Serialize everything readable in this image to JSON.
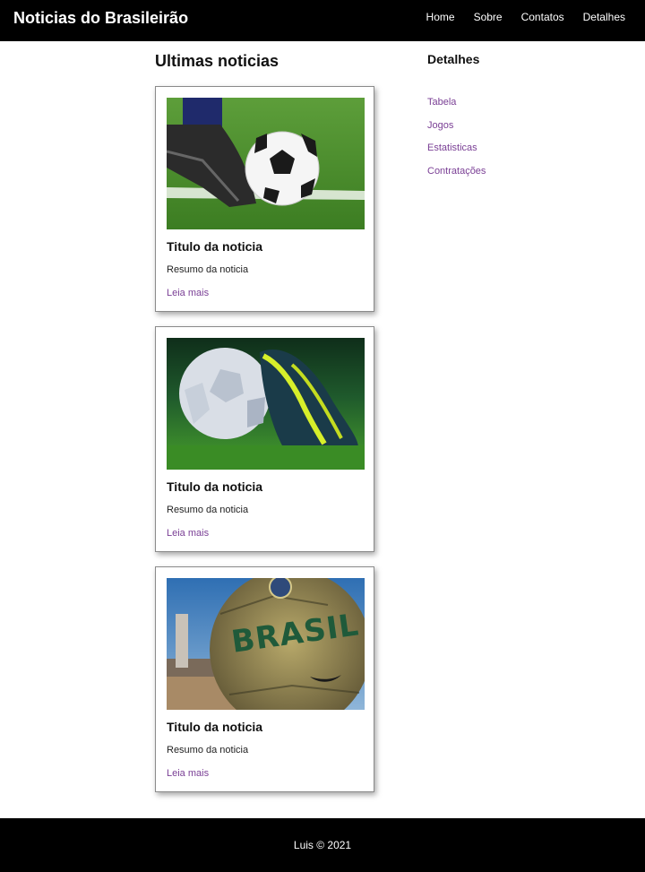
{
  "header": {
    "brand": "Noticias do Brasileirão",
    "nav": [
      "Home",
      "Sobre",
      "Contatos",
      "Detalhes"
    ]
  },
  "main": {
    "title": "Ultimas noticias",
    "cards": [
      {
        "title": "Titulo da noticia",
        "summary": "Resumo da noticia",
        "link": "Leia mais"
      },
      {
        "title": "Titulo da noticia",
        "summary": "Resumo da noticia",
        "link": "Leia mais"
      },
      {
        "title": "Titulo da noticia",
        "summary": "Resumo da noticia",
        "link": "Leia mais",
        "ball_text": "BRASIL"
      }
    ]
  },
  "aside": {
    "title": "Detalhes",
    "links": [
      "Tabela",
      "Jogos",
      "Estatisticas",
      "Contratações"
    ]
  },
  "footer": {
    "text": "Luis © 2021"
  },
  "colors": {
    "header_bg": "#000000",
    "link": "#7a3f95",
    "footer_bg": "#000000"
  }
}
